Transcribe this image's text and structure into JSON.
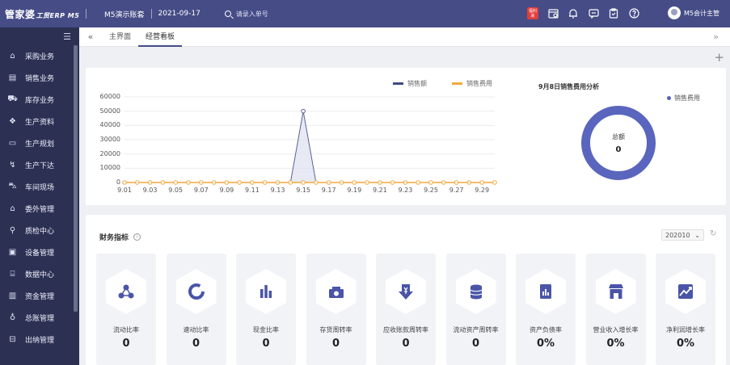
{
  "header": {
    "logo_text": "管家婆",
    "logo_sub": "工贸ERP M5",
    "account": "M5演示账套",
    "date": "2021-09-17",
    "search_placeholder": "请录入单号",
    "ad_badge": "福利来",
    "user_name": "M5会计主管"
  },
  "sidebar": {
    "items": [
      {
        "label": "采购业务",
        "icon": "basket-icon"
      },
      {
        "label": "销售业务",
        "icon": "clipboard-icon"
      },
      {
        "label": "库存业务",
        "icon": "truck-icon"
      },
      {
        "label": "生产资料",
        "icon": "layers-icon"
      },
      {
        "label": "生产规划",
        "icon": "folder-icon"
      },
      {
        "label": "生产下达",
        "icon": "flow-icon"
      },
      {
        "label": "车间现场",
        "icon": "car-icon"
      },
      {
        "label": "委外管理",
        "icon": "house-icon"
      },
      {
        "label": "质检中心",
        "icon": "inspect-icon"
      },
      {
        "label": "设备管理",
        "icon": "equipment-icon"
      },
      {
        "label": "数据中心",
        "icon": "database-icon"
      },
      {
        "label": "资金管理",
        "icon": "wallet-icon"
      },
      {
        "label": "总账管理",
        "icon": "ledger-icon"
      },
      {
        "label": "出纳管理",
        "icon": "cashier-icon"
      }
    ]
  },
  "tabs": [
    {
      "label": "主界面",
      "active": false
    },
    {
      "label": "经营看板",
      "active": true
    }
  ],
  "chart_data": {
    "type": "line",
    "series": [
      {
        "name": "销售额",
        "color": "#3d4a82",
        "values": [
          0,
          0,
          0,
          0,
          0,
          0,
          0,
          0,
          0,
          0,
          0,
          0,
          0,
          0,
          50000,
          0,
          0,
          0,
          0,
          0,
          0,
          0,
          0,
          0,
          0,
          0,
          0,
          0,
          0,
          0
        ]
      },
      {
        "name": "销售费用",
        "color": "#f2a93b",
        "values": [
          0,
          0,
          0,
          0,
          0,
          0,
          0,
          0,
          0,
          0,
          0,
          0,
          0,
          0,
          0,
          0,
          0,
          0,
          0,
          0,
          0,
          0,
          0,
          0,
          0,
          0,
          0,
          0,
          0,
          0
        ]
      }
    ],
    "x": [
      "9.01",
      "9.02",
      "9.03",
      "9.04",
      "9.05",
      "9.06",
      "9.07",
      "9.08",
      "9.09",
      "9.10",
      "9.11",
      "9.12",
      "9.13",
      "9.14",
      "9.15",
      "9.16",
      "9.17",
      "9.18",
      "9.19",
      "9.20",
      "9.21",
      "9.22",
      "9.23",
      "9.24",
      "9.25",
      "9.26",
      "9.27",
      "9.28",
      "9.29",
      "9.30"
    ],
    "x_tick_labels": [
      "9.01",
      "9.03",
      "9.05",
      "9.07",
      "9.09",
      "9.11",
      "9.13",
      "9.15",
      "9.17",
      "9.19",
      "9.21",
      "9.23",
      "9.25",
      "9.27",
      "9.29"
    ],
    "y_ticks": [
      0,
      10000,
      20000,
      30000,
      40000,
      50000,
      60000
    ],
    "ylim": [
      0,
      60000
    ],
    "grid": true,
    "legend": "top-center"
  },
  "donut": {
    "title": "9月8日销售费用分析",
    "legend": "销售费用",
    "center_label": "总额",
    "center_value": "0",
    "color": "#5a66bd"
  },
  "kpi": {
    "title": "财务指标",
    "info_icon": "i",
    "period": "202010",
    "cards": [
      {
        "label": "流动比率",
        "value": "0",
        "icon": "network-icon"
      },
      {
        "label": "速动比率",
        "value": "0",
        "icon": "ring-icon"
      },
      {
        "label": "现金比率",
        "value": "0",
        "icon": "bar-chart-icon"
      },
      {
        "label": "存货周转率",
        "value": "0",
        "icon": "cashbox-icon"
      },
      {
        "label": "应收账款周转率",
        "value": "0",
        "icon": "down-arrow-yen-icon"
      },
      {
        "label": "流动资产周转率",
        "value": "0",
        "icon": "coins-icon"
      },
      {
        "label": "资产负债率",
        "value": "0%",
        "icon": "report-icon"
      },
      {
        "label": "营业收入增长率",
        "value": "0%",
        "icon": "store-icon"
      },
      {
        "label": "净利润增长率",
        "value": "0%",
        "icon": "trend-icon"
      }
    ]
  }
}
